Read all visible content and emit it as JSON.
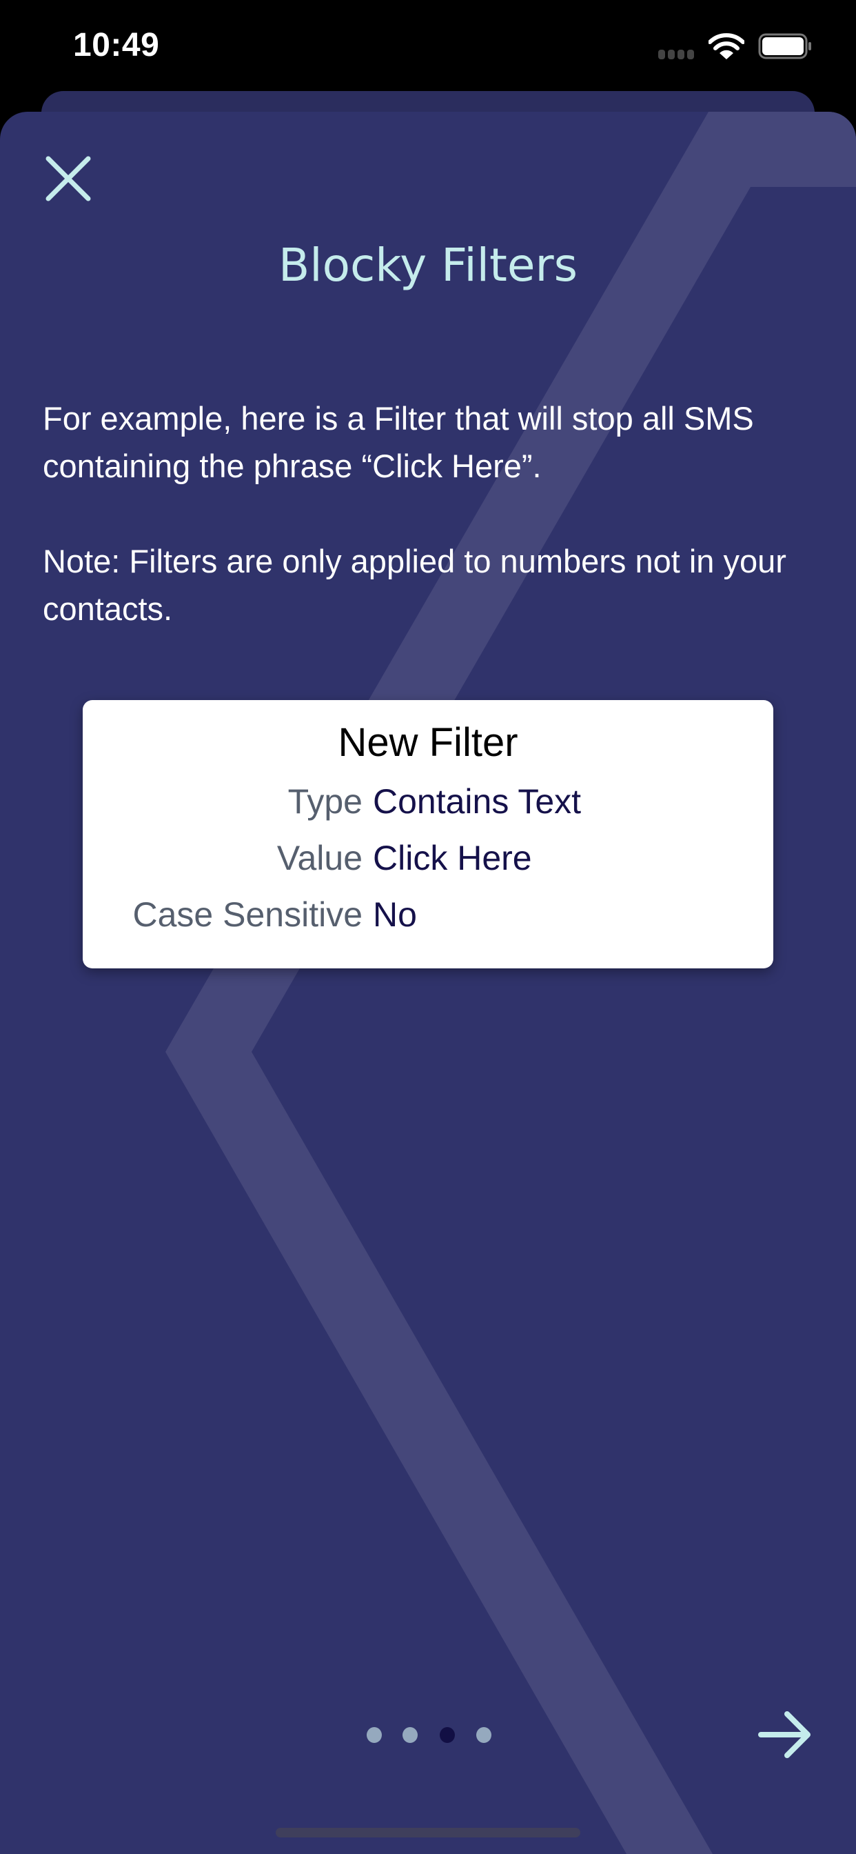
{
  "status_bar": {
    "time": "10:49"
  },
  "header": {
    "title": "Blocky Filters"
  },
  "body": {
    "intro": "For example, here is a Filter that will stop all SMS containing the phrase “Click Here”.",
    "note": "Note: Filters are only applied to numbers not in your contacts."
  },
  "filter_card": {
    "title": "New Filter",
    "rows": [
      {
        "label": "Type",
        "value": "Contains Text"
      },
      {
        "label": "Value",
        "value": "Click Here"
      },
      {
        "label": "Case Sensitive",
        "value": "No"
      }
    ]
  },
  "pagination": {
    "total": 4,
    "current": 3
  },
  "colors": {
    "background": "#30336b",
    "accent": "#c5ecec",
    "stripe": "#45477a",
    "dot": "#95a9be",
    "dot_active": "#120f44"
  }
}
